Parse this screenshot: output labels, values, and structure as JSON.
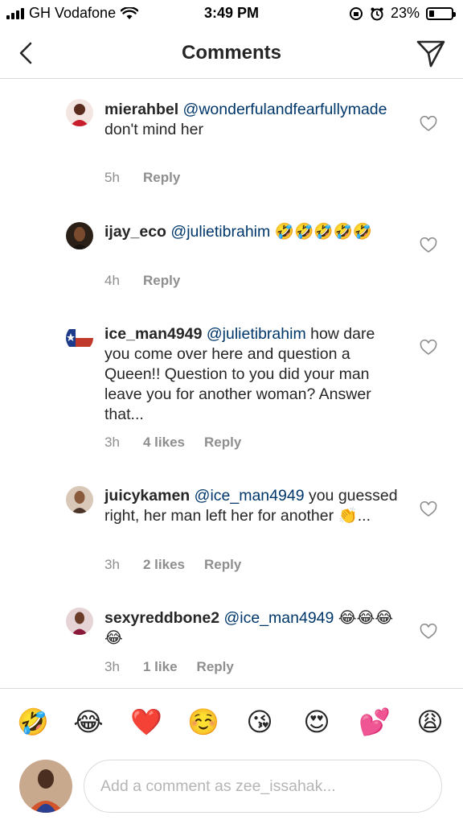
{
  "status_bar": {
    "carrier": "GH Vodafone",
    "time": "3:49 PM",
    "battery": "23%",
    "battery_level": 0.23
  },
  "header": {
    "title": "Comments"
  },
  "comments": [
    {
      "username": "mierahbel",
      "mention": "@wonderfulandfearfullymade",
      "text": " don't mind her",
      "time": "5h",
      "likes": "",
      "reply": "Reply"
    },
    {
      "username": "ijay_eco",
      "mention": "@julietibrahim",
      "text": " 🤣🤣🤣🤣🤣",
      "time": "4h",
      "likes": "",
      "reply": "Reply"
    },
    {
      "username": "ice_man4949",
      "mention": "@julietibrahim",
      "text": " how dare you come over here and question a Queen!! Question to you did your man leave you for another woman? Answer that...",
      "time": "3h",
      "likes": "4 likes",
      "reply": "Reply"
    },
    {
      "username": "juicykamen",
      "mention": "@ice_man4949",
      "text": " you guessed right, her man left her for another 👏...",
      "time": "3h",
      "likes": "2 likes",
      "reply": "Reply"
    },
    {
      "username": "sexyreddbone2",
      "mention": "@ice_man4949",
      "text": " 😂😂😂😂",
      "time": "3h",
      "likes": "1 like",
      "reply": "Reply"
    }
  ],
  "emoji_bar": [
    "🤣",
    "😂",
    "❤️",
    "☺️",
    "😘",
    "😍",
    "💕",
    "😩"
  ],
  "composer": {
    "placeholder": "Add a comment as zee_issahak..."
  },
  "colors": {
    "mention": "#00376b",
    "meta": "#8e8e8e",
    "divider": "#dbdbdb"
  }
}
